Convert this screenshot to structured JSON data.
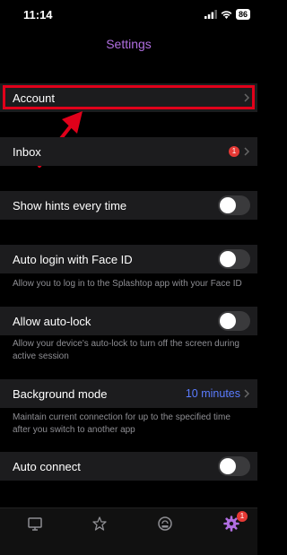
{
  "status": {
    "time": "11:14",
    "battery": "86"
  },
  "nav": {
    "title": "Settings"
  },
  "rows": {
    "account": {
      "label": "Account"
    },
    "inbox": {
      "label": "Inbox",
      "badge": "1"
    },
    "hints": {
      "label": "Show hints every time",
      "enabled": false
    },
    "faceid": {
      "label": "Auto login with Face ID",
      "enabled": false,
      "description": "Allow you to log in to the Splashtop app with your Face ID"
    },
    "autolock": {
      "label": "Allow auto-lock",
      "enabled": false,
      "description": "Allow your device's auto-lock to turn off the screen during active session"
    },
    "background": {
      "label": "Background mode",
      "value": "10 minutes",
      "description": "Maintain current connection for up to the specified time after you switch to another app"
    },
    "autoconnect": {
      "label": "Auto connect",
      "enabled": false
    }
  },
  "tabbar": {
    "settings_badge": "1"
  },
  "colors": {
    "accent": "#b06ee0",
    "link": "#5b7cff",
    "annotation": "#e0001a",
    "badge": "#e53935"
  }
}
